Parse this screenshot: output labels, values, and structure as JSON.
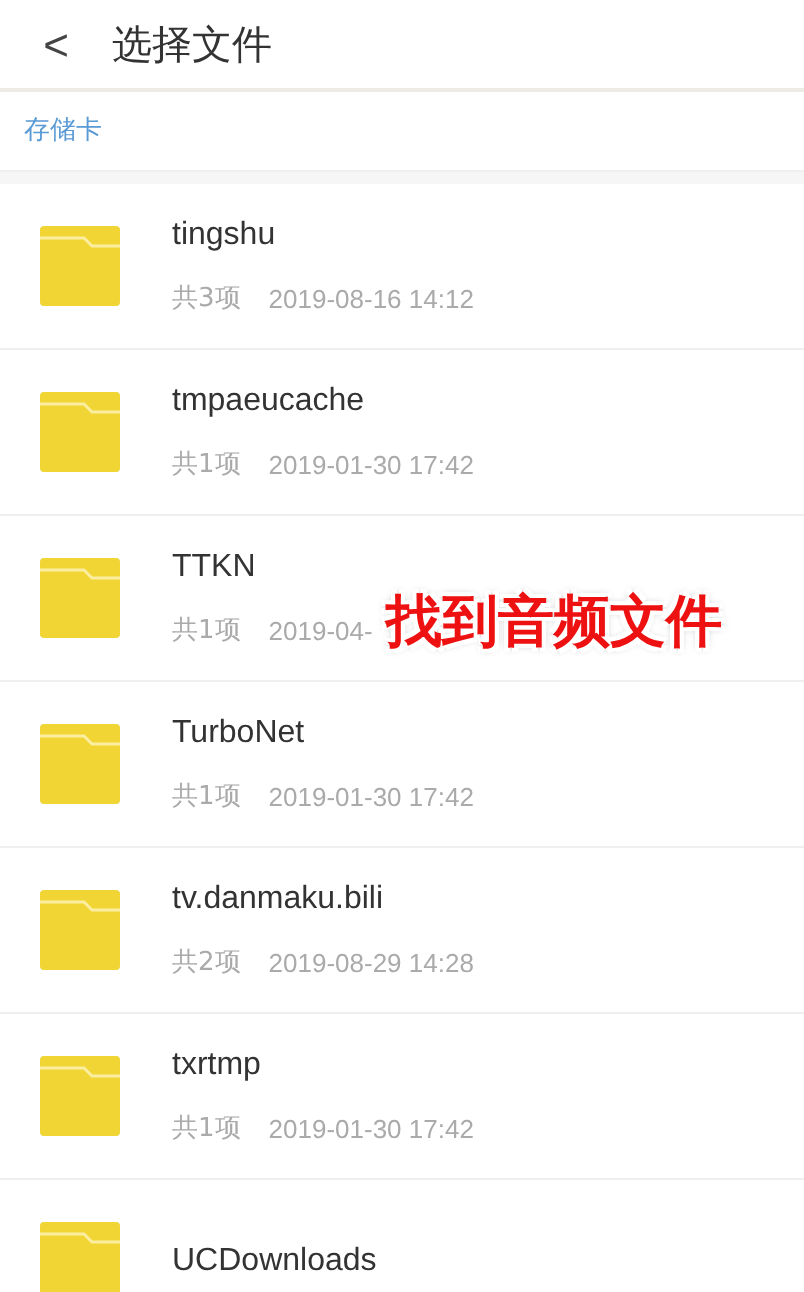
{
  "header": {
    "back": "<",
    "title": "选择文件"
  },
  "breadcrumb": "存储卡",
  "folders": [
    {
      "name": "tingshu",
      "count": "共3项",
      "date": "2019-08-16 14:12"
    },
    {
      "name": "tmpaeucache",
      "count": "共1项",
      "date": "2019-01-30 17:42"
    },
    {
      "name": "TTKN",
      "count": "共1项",
      "date": "2019-04-"
    },
    {
      "name": "TurboNet",
      "count": "共1项",
      "date": "2019-01-30 17:42"
    },
    {
      "name": "tv.danmaku.bili",
      "count": "共2项",
      "date": "2019-08-29 14:28"
    },
    {
      "name": "txrtmp",
      "count": "共1项",
      "date": "2019-01-30 17:42"
    },
    {
      "name": "UCDownloads"
    }
  ],
  "annotation": "找到音频文件"
}
